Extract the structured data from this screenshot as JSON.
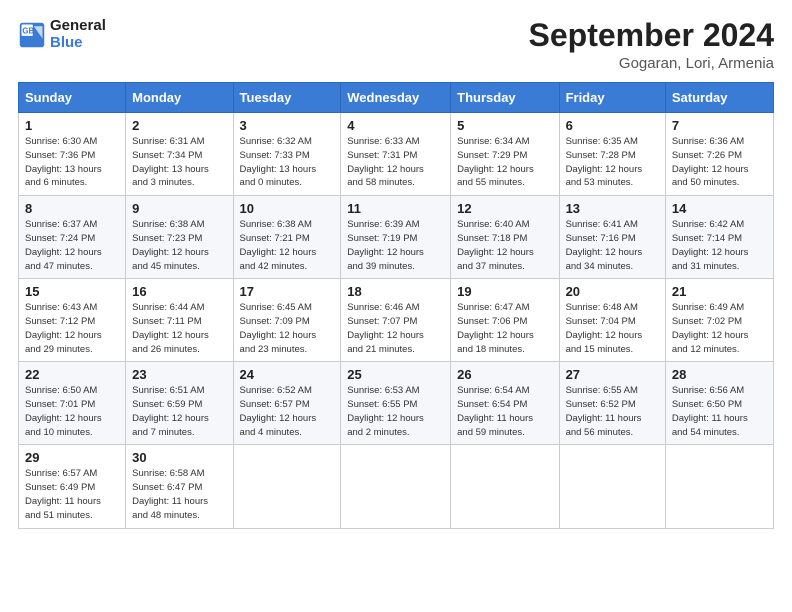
{
  "header": {
    "logo_line1": "General",
    "logo_line2": "Blue",
    "month": "September 2024",
    "location": "Gogaran, Lori, Armenia"
  },
  "days_of_week": [
    "Sunday",
    "Monday",
    "Tuesday",
    "Wednesday",
    "Thursday",
    "Friday",
    "Saturday"
  ],
  "weeks": [
    [
      {
        "day": "1",
        "info": "Sunrise: 6:30 AM\nSunset: 7:36 PM\nDaylight: 13 hours\nand 6 minutes."
      },
      {
        "day": "2",
        "info": "Sunrise: 6:31 AM\nSunset: 7:34 PM\nDaylight: 13 hours\nand 3 minutes."
      },
      {
        "day": "3",
        "info": "Sunrise: 6:32 AM\nSunset: 7:33 PM\nDaylight: 13 hours\nand 0 minutes."
      },
      {
        "day": "4",
        "info": "Sunrise: 6:33 AM\nSunset: 7:31 PM\nDaylight: 12 hours\nand 58 minutes."
      },
      {
        "day": "5",
        "info": "Sunrise: 6:34 AM\nSunset: 7:29 PM\nDaylight: 12 hours\nand 55 minutes."
      },
      {
        "day": "6",
        "info": "Sunrise: 6:35 AM\nSunset: 7:28 PM\nDaylight: 12 hours\nand 53 minutes."
      },
      {
        "day": "7",
        "info": "Sunrise: 6:36 AM\nSunset: 7:26 PM\nDaylight: 12 hours\nand 50 minutes."
      }
    ],
    [
      {
        "day": "8",
        "info": "Sunrise: 6:37 AM\nSunset: 7:24 PM\nDaylight: 12 hours\nand 47 minutes."
      },
      {
        "day": "9",
        "info": "Sunrise: 6:38 AM\nSunset: 7:23 PM\nDaylight: 12 hours\nand 45 minutes."
      },
      {
        "day": "10",
        "info": "Sunrise: 6:38 AM\nSunset: 7:21 PM\nDaylight: 12 hours\nand 42 minutes."
      },
      {
        "day": "11",
        "info": "Sunrise: 6:39 AM\nSunset: 7:19 PM\nDaylight: 12 hours\nand 39 minutes."
      },
      {
        "day": "12",
        "info": "Sunrise: 6:40 AM\nSunset: 7:18 PM\nDaylight: 12 hours\nand 37 minutes."
      },
      {
        "day": "13",
        "info": "Sunrise: 6:41 AM\nSunset: 7:16 PM\nDaylight: 12 hours\nand 34 minutes."
      },
      {
        "day": "14",
        "info": "Sunrise: 6:42 AM\nSunset: 7:14 PM\nDaylight: 12 hours\nand 31 minutes."
      }
    ],
    [
      {
        "day": "15",
        "info": "Sunrise: 6:43 AM\nSunset: 7:12 PM\nDaylight: 12 hours\nand 29 minutes."
      },
      {
        "day": "16",
        "info": "Sunrise: 6:44 AM\nSunset: 7:11 PM\nDaylight: 12 hours\nand 26 minutes."
      },
      {
        "day": "17",
        "info": "Sunrise: 6:45 AM\nSunset: 7:09 PM\nDaylight: 12 hours\nand 23 minutes."
      },
      {
        "day": "18",
        "info": "Sunrise: 6:46 AM\nSunset: 7:07 PM\nDaylight: 12 hours\nand 21 minutes."
      },
      {
        "day": "19",
        "info": "Sunrise: 6:47 AM\nSunset: 7:06 PM\nDaylight: 12 hours\nand 18 minutes."
      },
      {
        "day": "20",
        "info": "Sunrise: 6:48 AM\nSunset: 7:04 PM\nDaylight: 12 hours\nand 15 minutes."
      },
      {
        "day": "21",
        "info": "Sunrise: 6:49 AM\nSunset: 7:02 PM\nDaylight: 12 hours\nand 12 minutes."
      }
    ],
    [
      {
        "day": "22",
        "info": "Sunrise: 6:50 AM\nSunset: 7:01 PM\nDaylight: 12 hours\nand 10 minutes."
      },
      {
        "day": "23",
        "info": "Sunrise: 6:51 AM\nSunset: 6:59 PM\nDaylight: 12 hours\nand 7 minutes."
      },
      {
        "day": "24",
        "info": "Sunrise: 6:52 AM\nSunset: 6:57 PM\nDaylight: 12 hours\nand 4 minutes."
      },
      {
        "day": "25",
        "info": "Sunrise: 6:53 AM\nSunset: 6:55 PM\nDaylight: 12 hours\nand 2 minutes."
      },
      {
        "day": "26",
        "info": "Sunrise: 6:54 AM\nSunset: 6:54 PM\nDaylight: 11 hours\nand 59 minutes."
      },
      {
        "day": "27",
        "info": "Sunrise: 6:55 AM\nSunset: 6:52 PM\nDaylight: 11 hours\nand 56 minutes."
      },
      {
        "day": "28",
        "info": "Sunrise: 6:56 AM\nSunset: 6:50 PM\nDaylight: 11 hours\nand 54 minutes."
      }
    ],
    [
      {
        "day": "29",
        "info": "Sunrise: 6:57 AM\nSunset: 6:49 PM\nDaylight: 11 hours\nand 51 minutes."
      },
      {
        "day": "30",
        "info": "Sunrise: 6:58 AM\nSunset: 6:47 PM\nDaylight: 11 hours\nand 48 minutes."
      },
      null,
      null,
      null,
      null,
      null
    ]
  ]
}
